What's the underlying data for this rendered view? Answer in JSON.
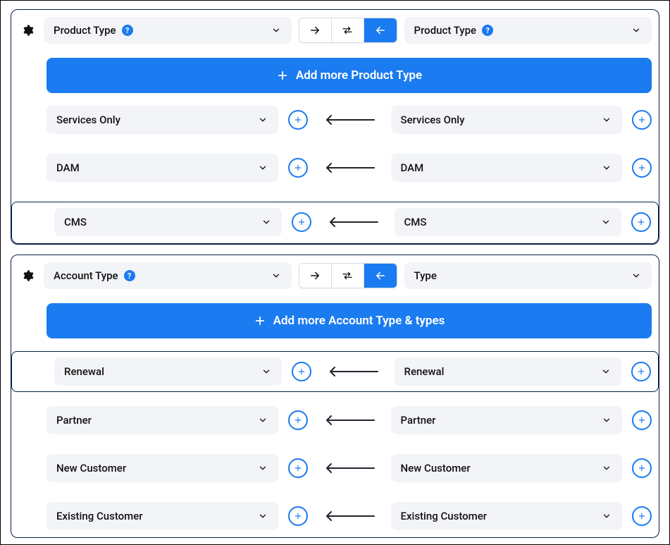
{
  "icons": {
    "help_glyph": "?"
  },
  "panels": [
    {
      "id": "product-type",
      "left_field": {
        "label": "Product Type",
        "help": true
      },
      "right_field": {
        "label": "Product Type",
        "help": true
      },
      "direction_selected": "left",
      "add_more_label": "Add more Product Type",
      "rows": [
        {
          "left": "Services Only",
          "right": "Services Only",
          "highlight": false
        },
        {
          "left": "DAM",
          "right": "DAM",
          "highlight": false
        },
        {
          "left": "CMS",
          "right": "CMS",
          "highlight": true
        }
      ]
    },
    {
      "id": "account-type",
      "left_field": {
        "label": "Account Type",
        "help": true
      },
      "right_field": {
        "label": "Type",
        "help": false
      },
      "direction_selected": "left",
      "add_more_label": "Add more Account Type & types",
      "rows": [
        {
          "left": "Renewal",
          "right": "Renewal",
          "highlight": true
        },
        {
          "left": "Partner",
          "right": "Partner",
          "highlight": false
        },
        {
          "left": "New Customer",
          "right": "New Customer",
          "highlight": false
        },
        {
          "left": "Existing Customer",
          "right": "Existing Customer",
          "highlight": false
        }
      ]
    }
  ]
}
